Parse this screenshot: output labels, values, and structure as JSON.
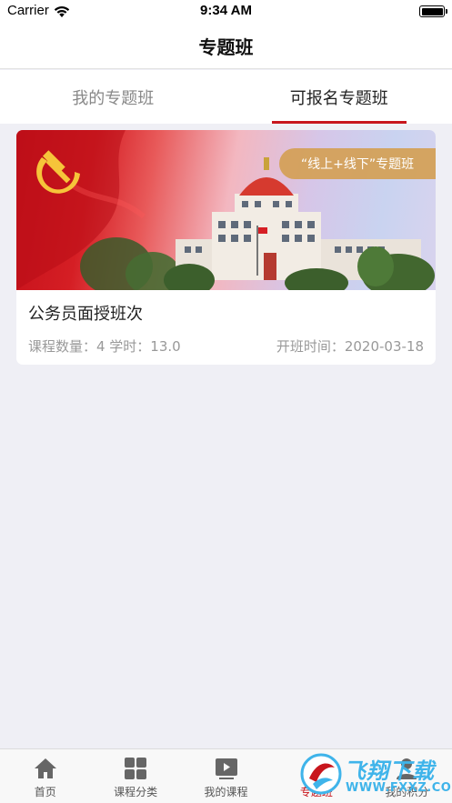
{
  "status_bar": {
    "carrier": "Carrier",
    "time": "9:34 AM"
  },
  "nav": {
    "title": "专题班"
  },
  "tabs": [
    {
      "label": "我的专题班",
      "active": false
    },
    {
      "label": "可报名专题班",
      "active": true
    }
  ],
  "card": {
    "badge": "“线上+线下”专题班",
    "title": "公务员面授班次",
    "meta_left": "课程数量：4 学时：13.0",
    "meta_right": "开班时间：2020-03-18"
  },
  "tab_bar": {
    "items": [
      {
        "label": "首页",
        "icon": "home-icon"
      },
      {
        "label": "课程分类",
        "icon": "grid-icon"
      },
      {
        "label": "我的课程",
        "icon": "play-icon"
      },
      {
        "label": "专题班",
        "icon": "topic-icon",
        "active": true
      },
      {
        "label": "我的积分",
        "icon": "user-icon"
      }
    ]
  },
  "watermark": {
    "text": "飞翔下载",
    "url": "WWW.FXXZ.COM"
  },
  "colors": {
    "accent": "#c8161d",
    "badge": "#d4a055",
    "watermark": "#3fb4ea"
  }
}
